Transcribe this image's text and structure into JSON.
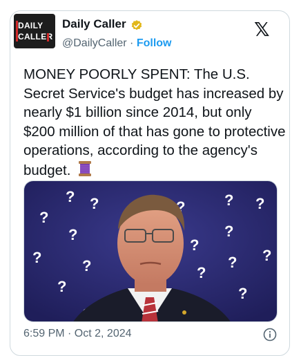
{
  "account": {
    "logo_line1": "DAILY",
    "logo_line2": "CALLER",
    "name": "Daily Caller",
    "handle": "@DailyCaller",
    "separator": "·",
    "follow_label": "Follow",
    "verified_icon": "gold-verified-badge-icon",
    "platform_icon": "x-logo-icon",
    "x_glyph": "𝕏"
  },
  "post": {
    "text": "MONEY POORLY SPENT: The U.S. Secret Service's budget has increased by nearly $1 billion since 2014, but only $200 million of that has gone to protective operations, according to the agency's budget.",
    "emoji_icon": "thread-spool-icon",
    "media_description_icon": "photo-man-with-question-marks-icon",
    "question_mark": "?",
    "timestamp": "6:59 PM · Oct 2, 2024",
    "info_icon": "info-icon"
  },
  "colors": {
    "accent": "#1d9bf0",
    "brand_red": "#d32a2a",
    "media_bg": "#2c2b73",
    "verified_gold": "#e2b719"
  }
}
